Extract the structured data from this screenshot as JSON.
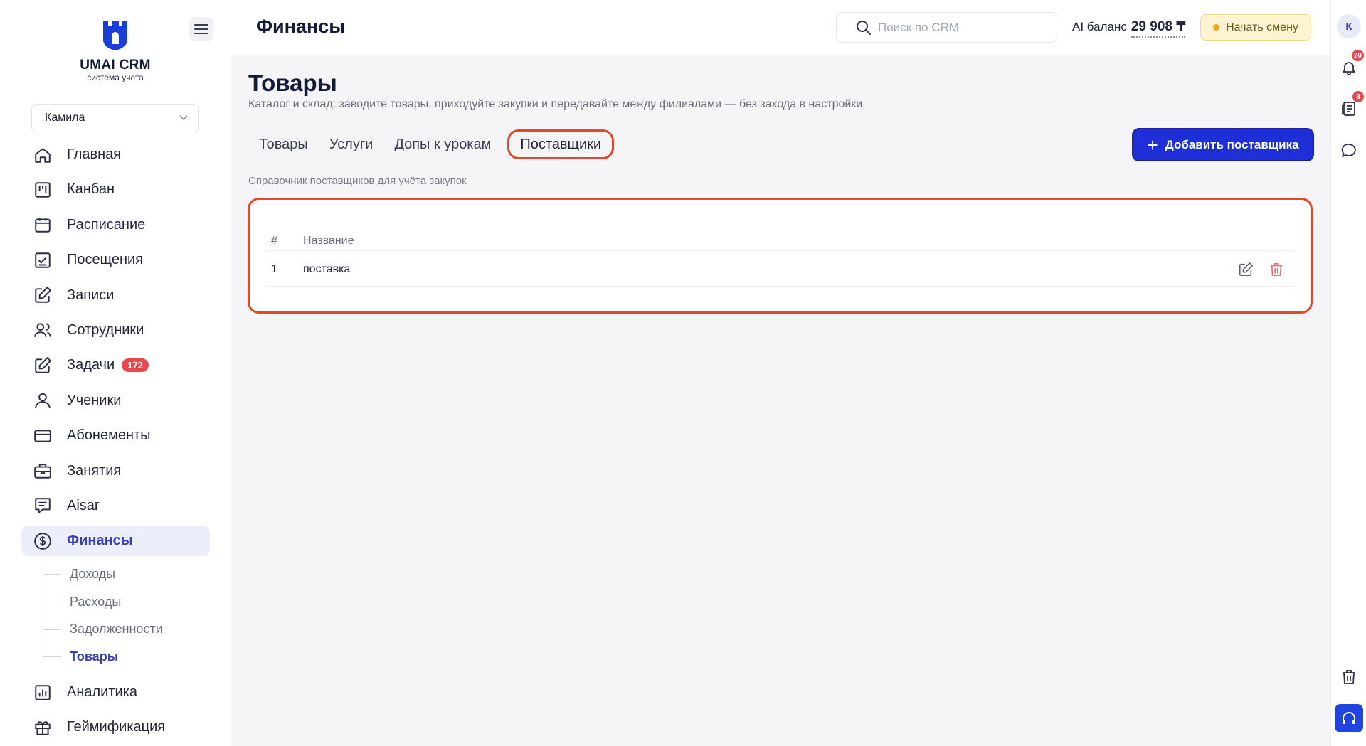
{
  "brand": {
    "title": "UMAI CRM",
    "subtitle": "система учета"
  },
  "user_select": {
    "value": "Камила"
  },
  "sidebar": {
    "items": [
      {
        "label": "Главная",
        "icon": "home-icon"
      },
      {
        "label": "Канбан",
        "icon": "kanban-icon"
      },
      {
        "label": "Расписание",
        "icon": "calendar-icon"
      },
      {
        "label": "Посещения",
        "icon": "attendance-icon"
      },
      {
        "label": "Записи",
        "icon": "edit-icon"
      },
      {
        "label": "Сотрудники",
        "icon": "users-icon"
      },
      {
        "label": "Задачи",
        "icon": "tasks-icon",
        "badge": "172"
      },
      {
        "label": "Ученики",
        "icon": "user-icon"
      },
      {
        "label": "Абонементы",
        "icon": "card-icon"
      },
      {
        "label": "Занятия",
        "icon": "briefcase-icon"
      },
      {
        "label": "Aisar",
        "icon": "chat-icon"
      },
      {
        "label": "Финансы",
        "icon": "dollar-icon",
        "active": true
      }
    ],
    "subitems": [
      {
        "label": "Доходы"
      },
      {
        "label": "Расходы"
      },
      {
        "label": "Задолженности"
      },
      {
        "label": "Товары",
        "active": true
      }
    ],
    "items_after": [
      {
        "label": "Аналитика",
        "icon": "chart-icon"
      },
      {
        "label": "Геймификация",
        "icon": "gift-icon"
      }
    ]
  },
  "header": {
    "title": "Финансы",
    "search_placeholder": "Поиск по CRM",
    "ai_balance_label": "AI баланс",
    "ai_balance_value": "29 908 ₸",
    "shift_button": "Начать смену"
  },
  "rail": {
    "avatar": "К",
    "notifications_badge": "20",
    "docs_badge": "3"
  },
  "page": {
    "title": "Товары",
    "description": "Каталог и склад: заводите товары, приходуйте закупки и передавайте между филиалами — без захода в настройки.",
    "tabs": [
      {
        "label": "Товары"
      },
      {
        "label": "Услуги"
      },
      {
        "label": "Допы к урокам"
      },
      {
        "label": "Поставщики",
        "active": true
      }
    ],
    "add_button": "Добавить поставщика",
    "section_hint": "Справочник поставщиков для учёта закупок",
    "table": {
      "columns": [
        "#",
        "Название"
      ],
      "rows": [
        {
          "num": "1",
          "name": "поставка"
        }
      ]
    }
  },
  "colors": {
    "accent": "#1f2fd8",
    "active_nav": "#3a3fb5",
    "highlight": "#e04a2a",
    "badge": "#e5484d"
  }
}
